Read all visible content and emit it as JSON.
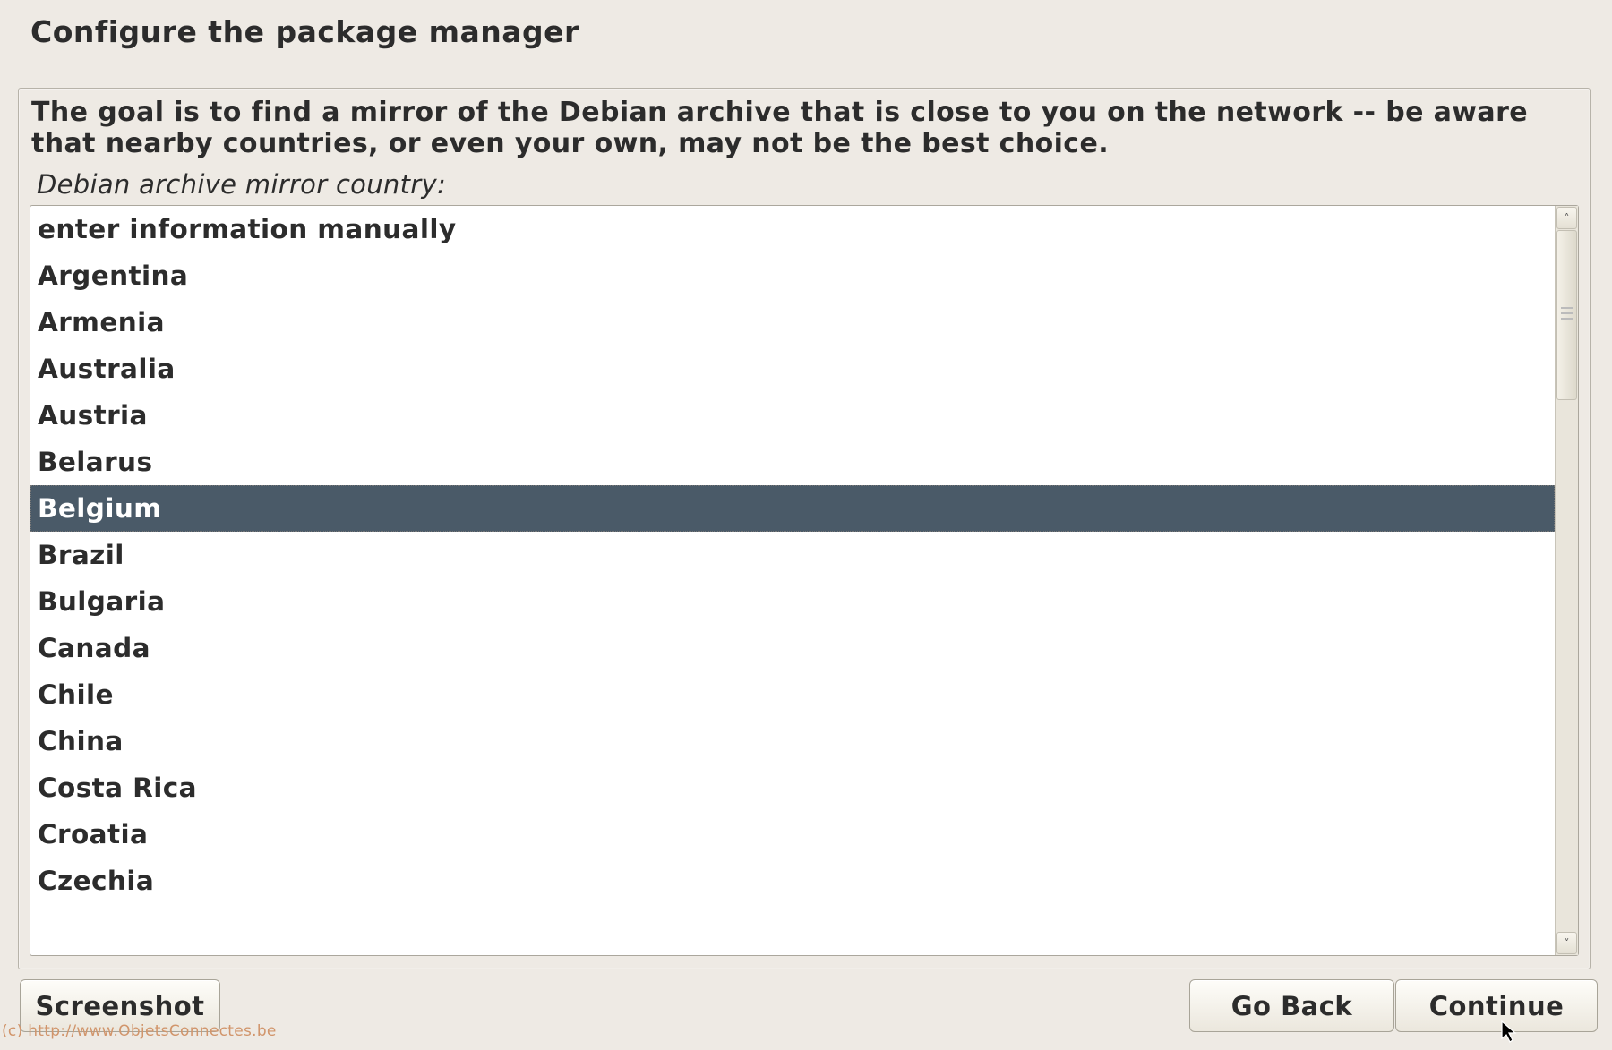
{
  "title": "Configure the package manager",
  "description": "The goal is to find a mirror of the Debian archive that is close to you on the network -- be aware that nearby countries, or even your own, may not be the best choice.",
  "prompt_label": "Debian archive mirror country:",
  "countries": [
    "enter information manually",
    "Argentina",
    "Armenia",
    "Australia",
    "Austria",
    "Belarus",
    "Belgium",
    "Brazil",
    "Bulgaria",
    "Canada",
    "Chile",
    "China",
    "Costa Rica",
    "Croatia",
    "Czechia"
  ],
  "selected_index": 6,
  "buttons": {
    "screenshot": "Screenshot",
    "go_back": "Go Back",
    "continue": "Continue"
  },
  "watermark": "(c) http://www.ObjetsConnectes.be",
  "scrollbar": {
    "up": "˄",
    "down": "˅"
  }
}
